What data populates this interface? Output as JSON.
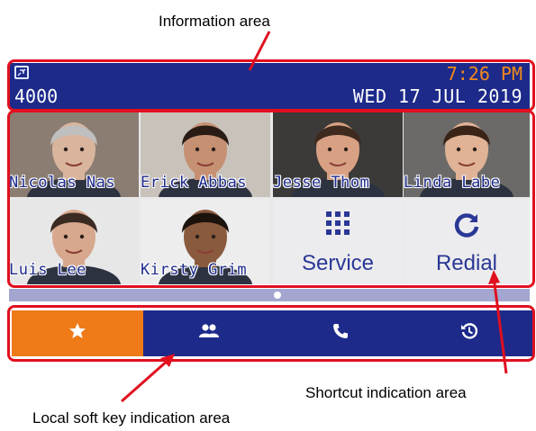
{
  "callouts": {
    "information_area": "Information area",
    "shortcut_area": "Shortcut indication area",
    "local_softkey_area": "Local soft key indication area"
  },
  "info": {
    "extension": "4000",
    "time": "7:26 PM",
    "date": "WED 17 JUL 2019",
    "status_icon": "phone-status-icon"
  },
  "shortcuts": {
    "contacts": [
      {
        "label": "Nicolas Nas",
        "skin": "#d9b59e",
        "hair": "#bfbfbf",
        "bg": "#8b7d72"
      },
      {
        "label": "Erick Abbas",
        "skin": "#c69073",
        "hair": "#2a1c14",
        "bg": "#c8c2ba"
      },
      {
        "label": "Jesse Thom",
        "skin": "#d8a184",
        "hair": "#3e2a1e",
        "bg": "#3b3a38"
      },
      {
        "label": "Linda Labe",
        "skin": "#e0b397",
        "hair": "#3a2418",
        "bg": "#6b6a68"
      },
      {
        "label": "Luis Lee",
        "skin": "#d7a88e",
        "hair": "#3b2a22",
        "bg": "#e7e7e7"
      },
      {
        "label": "Kirsty Grim",
        "skin": "#8a5a3e",
        "hair": "#1c120c",
        "bg": "#ededed"
      }
    ],
    "service_label": "Service",
    "redial_label": "Redial"
  },
  "softkeys": [
    {
      "icon": "star-icon",
      "active": true
    },
    {
      "icon": "people-icon",
      "active": false
    },
    {
      "icon": "phone-icon",
      "active": false
    },
    {
      "icon": "history-icon",
      "active": false
    }
  ],
  "colors": {
    "brand_blue": "#1d2a8a",
    "accent_orange": "#ee7a18",
    "highlight_red": "#e0101f"
  },
  "pager": {
    "current": 1,
    "total": 1
  }
}
